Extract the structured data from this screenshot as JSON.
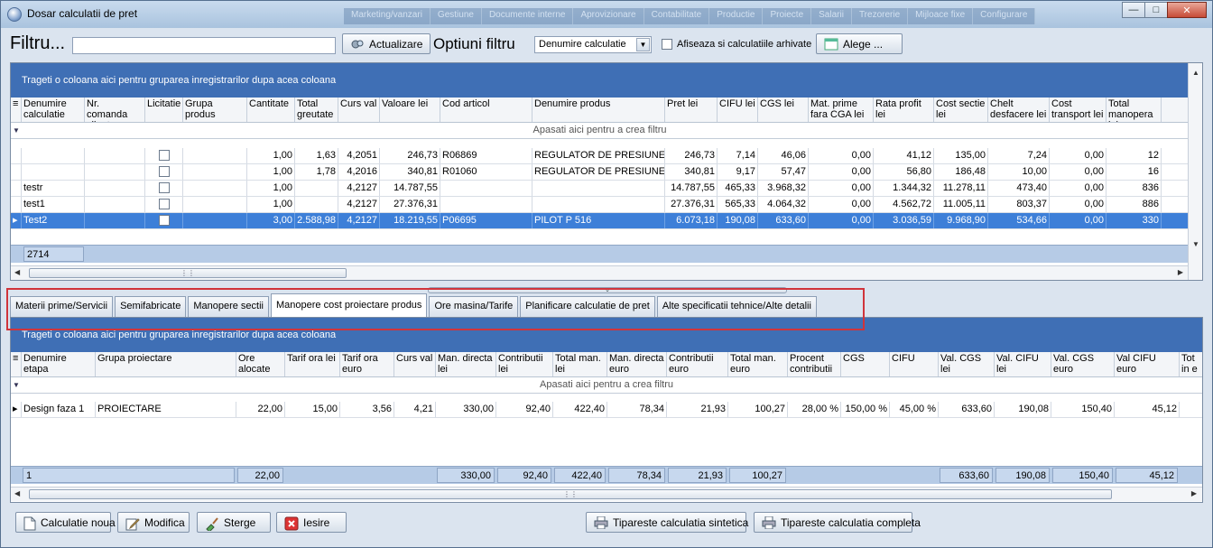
{
  "window": {
    "title": "Dosar calculatii de pret",
    "background_menu": [
      "Marketing/vanzari",
      "Gestiune",
      "Documente interne",
      "Aprovizionare",
      "Contabilitate",
      "Productie",
      "Proiecte",
      "Salarii",
      "Trezorerie",
      "Mijloace fixe",
      "Configurare"
    ]
  },
  "filter": {
    "label": "Filtru...",
    "value": "",
    "refresh_button": "Actualizare",
    "options_label": "Optiuni filtru",
    "field_select": "Denumire calculatie",
    "archived_label": "Afiseaza si calculatiile arhivate",
    "archived_checked": false,
    "choose_button": "Alege ..."
  },
  "top_grid": {
    "group_hint": "Trageti o coloana aici pentru gruparea inregistrarilor dupa acea coloana",
    "filter_hint": "Apasati aici pentru a  crea filtru",
    "columns": [
      "Denumire calculatie",
      "Nr. comanda client",
      "Licitatie",
      "Grupa produs",
      "Cantitate",
      "Total greutate",
      "Curs val",
      "Valoare lei",
      "Cod articol",
      "Denumire produs",
      "Pret lei",
      "CIFU lei",
      "CGS lei",
      "Mat. prime fara CGA lei",
      "Rata profit lei",
      "Cost sectie lei",
      "Chelt desfacere lei",
      "Cost transport lei",
      "Total manopera lei"
    ],
    "rows": [
      [
        "",
        "",
        "",
        "",
        "1,00",
        "1,63",
        "4,2051",
        "246,73",
        "R06869",
        "REGULATOR DE PRESIUNE RT",
        "246,73",
        "7,14",
        "46,06",
        "0,00",
        "41,12",
        "135,00",
        "7,24",
        "0,00",
        "12"
      ],
      [
        "",
        "",
        "",
        "",
        "1,00",
        "1,78",
        "4,2016",
        "340,81",
        "R01060",
        "REGULATOR DE PRESIUNE RT",
        "340,81",
        "9,17",
        "57,47",
        "0,00",
        "56,80",
        "186,48",
        "10,00",
        "0,00",
        "16"
      ],
      [
        "testr",
        "",
        "",
        "",
        "1,00",
        "",
        "4,2127",
        "14.787,55",
        "",
        "",
        "14.787,55",
        "465,33",
        "3.968,32",
        "0,00",
        "1.344,32",
        "11.278,11",
        "473,40",
        "0,00",
        "836"
      ],
      [
        "test1",
        "",
        "",
        "",
        "1,00",
        "",
        "4,2127",
        "27.376,31",
        "",
        "",
        "27.376,31",
        "565,33",
        "4.064,32",
        "0,00",
        "4.562,72",
        "11.005,11",
        "803,37",
        "0,00",
        "886"
      ],
      [
        "Test2",
        "",
        "",
        "",
        "3,00",
        "2.588,98",
        "4,2127",
        "18.219,55",
        "P06695",
        "PILOT P 516",
        "6.073,18",
        "190,08",
        "633,60",
        "0,00",
        "3.036,59",
        "9.968,90",
        "534,66",
        "0,00",
        "330"
      ]
    ],
    "selected_row": 4,
    "footer_count": "2714"
  },
  "tabs": [
    {
      "label": "Materii prime/Servicii"
    },
    {
      "label": "Semifabricate"
    },
    {
      "label": "Manopere sectii"
    },
    {
      "label": "Manopere cost proiectare produs",
      "active": true
    },
    {
      "label": "Ore masina/Tarife"
    },
    {
      "label": "Planificare calculatie de pret"
    },
    {
      "label": "Alte specificatii tehnice/Alte detalii"
    }
  ],
  "bottom_grid": {
    "group_hint": "Trageti o coloana aici pentru gruparea inregistrarilor dupa acea coloana",
    "filter_hint": "Apasati aici pentru a  crea filtru",
    "columns": [
      "Denumire etapa",
      "Grupa proiectare",
      "Ore alocate",
      "Tarif ora lei",
      "Tarif ora euro",
      "Curs val",
      "Man. directa lei",
      "Contributii lei",
      "Total man. lei",
      "Man. directa euro",
      "Contributii euro",
      "Total man. euro",
      "Procent contributii",
      "CGS",
      "CIFU",
      "Val. CGS lei",
      "Val. CIFU lei",
      "Val. CGS euro",
      "Val CIFU euro",
      "Tot in e"
    ],
    "rows": [
      [
        "Design faza 1",
        "PROIECTARE",
        "22,00",
        "15,00",
        "3,56",
        "4,21",
        "330,00",
        "92,40",
        "422,40",
        "78,34",
        "21,93",
        "100,27",
        "28,00 %",
        "150,00 %",
        "45,00 %",
        "633,60",
        "190,08",
        "150,40",
        "45,12",
        ""
      ]
    ],
    "footer": {
      "count": "1",
      "ore": "22,00",
      "man_directa_lei": "330,00",
      "contributii_lei": "92,40",
      "total_man_lei": "422,40",
      "man_directa_euro": "78,34",
      "contributii_euro": "21,93",
      "total_man_euro": "100,27",
      "val_cgs_lei": "633,60",
      "val_cifu_lei": "190,08",
      "val_cgs_euro": "150,40",
      "val_cifu_euro": "45,12"
    }
  },
  "actions": {
    "new": "Calculatie noua",
    "edit": "Modifica",
    "delete": "Sterge",
    "exit": "Iesire",
    "print_summary": "Tipareste calculatia sintetica",
    "print_full": "Tipareste calculatia completa"
  }
}
